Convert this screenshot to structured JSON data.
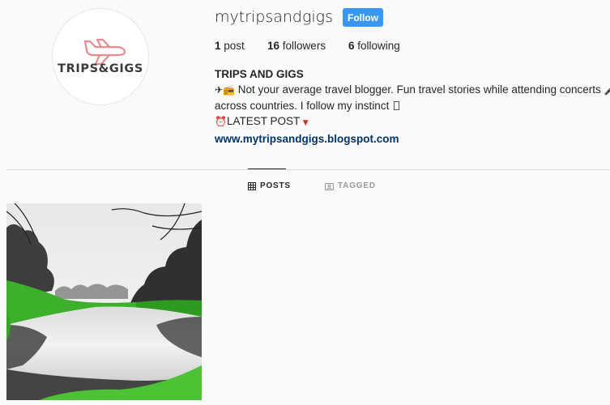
{
  "profile": {
    "username": "mytripsandgigs",
    "follow_label": "Follow",
    "avatar_logo_text": "TRIPS&GIGS"
  },
  "stats": {
    "posts_count": "1",
    "posts_label": "post",
    "followers_count": "16",
    "followers_label": "followers",
    "following_count": "6",
    "following_label": "following"
  },
  "bio": {
    "name": "TRIPS AND GIGS",
    "line1_emoji": "✈📻",
    "line1_text": " Not your average travel blogger. Fun travel stories while attending concerts ",
    "line1_end_emoji": "🎤",
    "line2_text": "across countries. I follow my instinct ",
    "line3_emoji": "⏰",
    "line3_text": "LATEST POST ",
    "line3_end_emoji": "▼",
    "link": "www.mytripsandgigs.blogspot.com"
  },
  "tabs": [
    {
      "label": "POSTS",
      "icon": "grid-icon",
      "active": true
    },
    {
      "label": "TAGGED",
      "icon": "tagged-icon",
      "active": false
    }
  ],
  "colors": {
    "follow_button": "#3897f0",
    "link": "#003569",
    "logo_plane": "#e88a8f",
    "background": "#fafafa"
  }
}
